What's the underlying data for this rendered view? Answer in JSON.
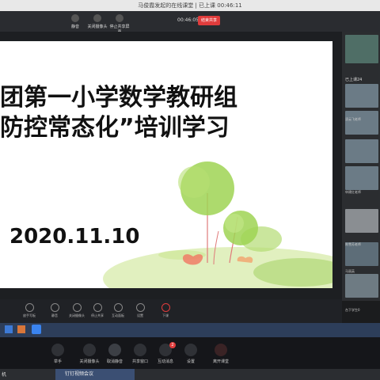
{
  "header": {
    "title": "马俊霞发起的在线课堂 | 已上课 00:46:11",
    "controls": [
      "静音",
      "关闭摄像头",
      "停止共享屏幕"
    ],
    "timer": "00:46:05",
    "end_label": "结束共享"
  },
  "slide": {
    "line1": "团第一小学数学教研组",
    "line2": "防控常态化”培训学习",
    "date": "2020.11.10"
  },
  "right_panel": {
    "online_label": "已上课24",
    "participants": [
      "",
      "凌云飞老师",
      "",
      "申建红老师",
      "",
      "陈雪芳老师",
      "马丽英"
    ],
    "footer": "台下学生0"
  },
  "toolbar1": {
    "items": [
      "放手写板",
      "静音",
      "关闭摄像头",
      "停止共享",
      "互动面板",
      "设置",
      "下课"
    ]
  },
  "toolbar2": {
    "items": [
      "举手",
      "关闭摄像头",
      "取消静音",
      "共享窗口",
      "互动消息",
      "设置",
      "离开课堂"
    ],
    "message_badge": "2"
  },
  "taskbar": {
    "left_text": "机",
    "tab_label": "钉钉视频会议"
  },
  "colors": {
    "accent_red": "#e03c3c",
    "dark_bg": "#1b1c1e",
    "slide_bg": "#ffffff",
    "leaf_green": "#9fd453"
  }
}
